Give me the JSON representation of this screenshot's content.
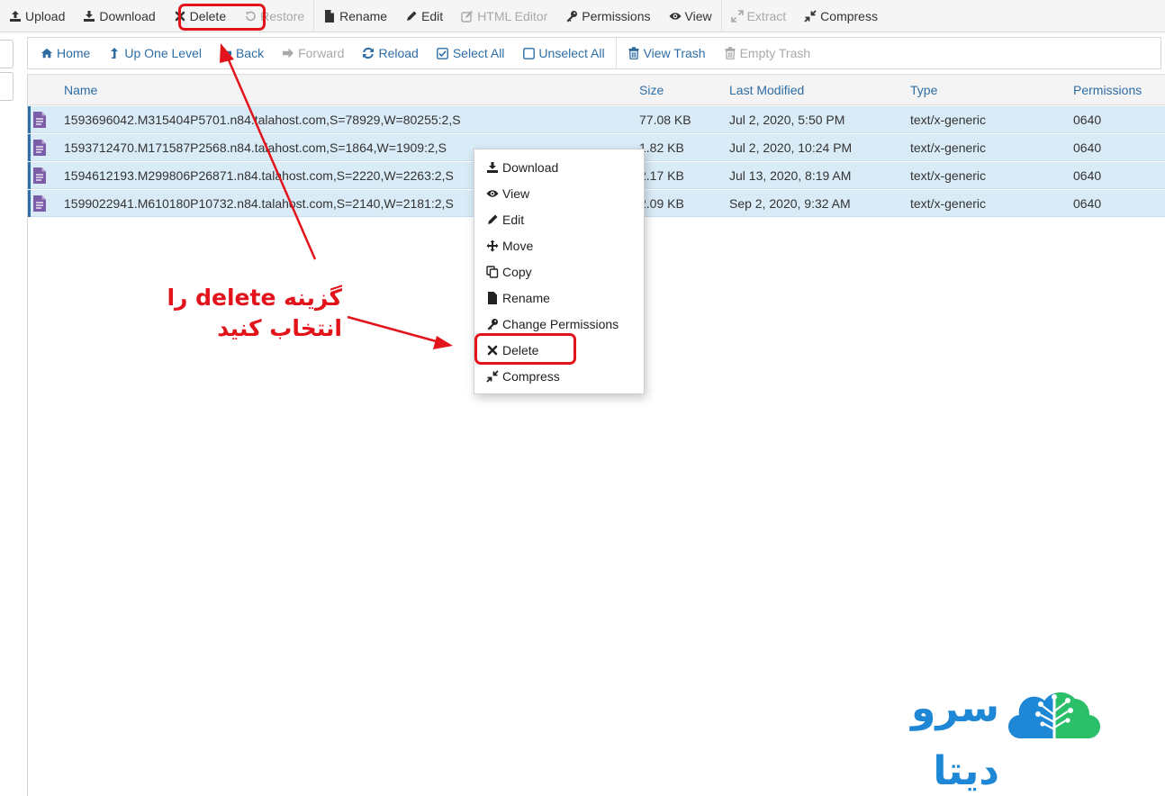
{
  "top_toolbar": {
    "upload": "Upload",
    "download": "Download",
    "delete": "Delete",
    "restore": "Restore",
    "rename": "Rename",
    "edit": "Edit",
    "html_editor": "HTML Editor",
    "permissions": "Permissions",
    "view": "View",
    "extract": "Extract",
    "compress": "Compress"
  },
  "nav_toolbar": {
    "home": "Home",
    "up_one_level": "Up One Level",
    "back": "Back",
    "forward": "Forward",
    "reload": "Reload",
    "select_all": "Select All",
    "unselect_all": "Unselect All",
    "view_trash": "View Trash",
    "empty_trash": "Empty Trash"
  },
  "table": {
    "headers": {
      "name": "Name",
      "size": "Size",
      "last_modified": "Last Modified",
      "type": "Type",
      "permissions": "Permissions"
    },
    "rows": [
      {
        "name": "1593696042.M315404P5701.n84.talahost.com,S=78929,W=80255:2,S",
        "size": "77.08 KB",
        "modified": "Jul 2, 2020, 5:50 PM",
        "type": "text/x-generic",
        "perms": "0640"
      },
      {
        "name": "1593712470.M171587P2568.n84.talahost.com,S=1864,W=1909:2,S",
        "size": "1.82 KB",
        "modified": "Jul 2, 2020, 10:24 PM",
        "type": "text/x-generic",
        "perms": "0640"
      },
      {
        "name": "1594612193.M299806P26871.n84.talahost.com,S=2220,W=2263:2,S",
        "size": "2.17 KB",
        "modified": "Jul 13, 2020, 8:19 AM",
        "type": "text/x-generic",
        "perms": "0640"
      },
      {
        "name": "1599022941.M610180P10732.n84.talahost.com,S=2140,W=2181:2,S",
        "size": "2.09 KB",
        "modified": "Sep 2, 2020, 9:32 AM",
        "type": "text/x-generic",
        "perms": "0640"
      }
    ]
  },
  "context_menu": {
    "download": "Download",
    "view": "View",
    "edit": "Edit",
    "move": "Move",
    "copy": "Copy",
    "rename": "Rename",
    "change_permissions": "Change Permissions",
    "delete": "Delete",
    "compress": "Compress"
  },
  "annotation": {
    "line1": "گزینه delete را",
    "line2": "انتخاب کنید",
    "color": "#e3131b"
  },
  "logo": {
    "text": "سرو دیتا"
  },
  "colors": {
    "link_blue": "#2e6da4",
    "selected_row": "#d9ebf7",
    "file_icon": "#7b5ea7",
    "logo_blue": "#1e88d6",
    "logo_green": "#2cbf6a"
  }
}
